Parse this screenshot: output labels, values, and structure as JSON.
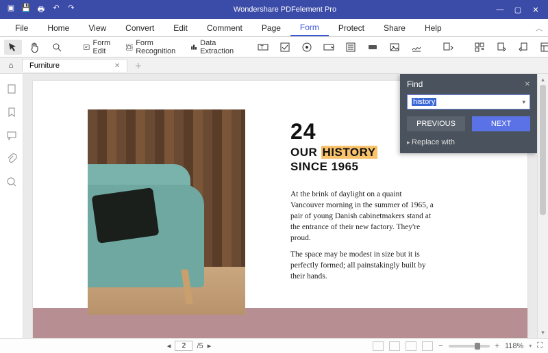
{
  "app": {
    "title": "Wondershare PDFelement Pro"
  },
  "menu": {
    "items": [
      "File",
      "Home",
      "View",
      "Convert",
      "Edit",
      "Comment",
      "Page",
      "Form",
      "Protect",
      "Share",
      "Help"
    ],
    "active": "Form"
  },
  "toolbar": {
    "form_edit": "Form Edit",
    "form_recognition": "Form Recognition",
    "data_extraction": "Data Extraction"
  },
  "tabs": {
    "name": "Furniture"
  },
  "document": {
    "number": "24",
    "heading_pre": "OUR ",
    "heading_hl": "HISTORY",
    "heading_post_line2": "SINCE 1965",
    "para1": "At the brink of daylight on a quaint Vancouver morning in the summer of 1965, a pair of young Danish cabinetmakers stand at the entrance of their new factory. They're proud.",
    "para2": "The space may be modest in size but it is perfectly formed; all painstakingly built by their hands."
  },
  "find": {
    "title": "Find",
    "value": "history",
    "previous": "PREVIOUS",
    "next": "NEXT",
    "replace": "Replace with"
  },
  "status": {
    "page_current": "2",
    "page_total": "/5",
    "zoom": "118%"
  }
}
